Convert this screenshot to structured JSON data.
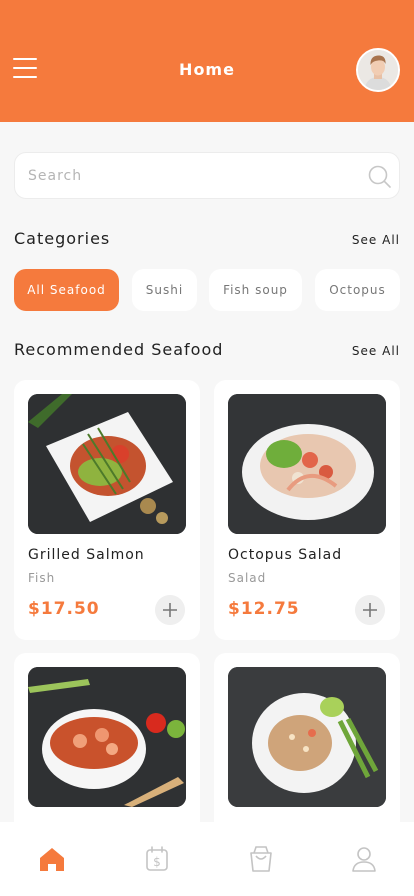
{
  "header": {
    "title": "Home"
  },
  "search": {
    "placeholder": "Search"
  },
  "categories": {
    "title": "Categories",
    "see_all": "See All",
    "chips": [
      "All Seafood",
      "Sushi",
      "Fish soup",
      "Octopus"
    ],
    "active_index": 0
  },
  "recommended": {
    "title": "Recommended Seafood",
    "see_all": "See All",
    "items": [
      {
        "name": "Grilled Salmon",
        "category": "Fish",
        "price": "$17.50"
      },
      {
        "name": "Octopus Salad",
        "category": "Salad",
        "price": "$12.75"
      }
    ]
  },
  "tabbar": {
    "items": [
      "home-icon",
      "receipt-icon",
      "bag-icon",
      "profile-icon"
    ],
    "active_index": 0
  },
  "colors": {
    "accent": "#f57a3d",
    "background": "#f7f7f7",
    "inactive_icon": "#c4c4c4"
  }
}
